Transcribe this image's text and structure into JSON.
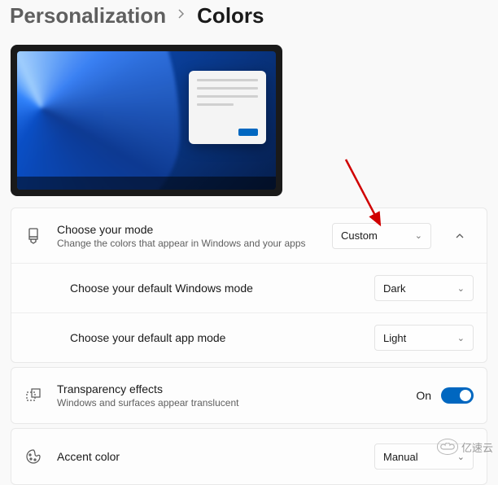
{
  "breadcrumb": {
    "parent": "Personalization",
    "current": "Colors"
  },
  "mode": {
    "title": "Choose your mode",
    "subtitle": "Change the colors that appear in Windows and your apps",
    "selected": "Custom",
    "windows_mode": {
      "label": "Choose your default Windows mode",
      "selected": "Dark"
    },
    "app_mode": {
      "label": "Choose your default app mode",
      "selected": "Light"
    }
  },
  "transparency": {
    "title": "Transparency effects",
    "subtitle": "Windows and surfaces appear translucent",
    "state_label": "On"
  },
  "accent": {
    "title": "Accent color",
    "selected": "Manual"
  },
  "watermark": {
    "text": "亿速云"
  }
}
